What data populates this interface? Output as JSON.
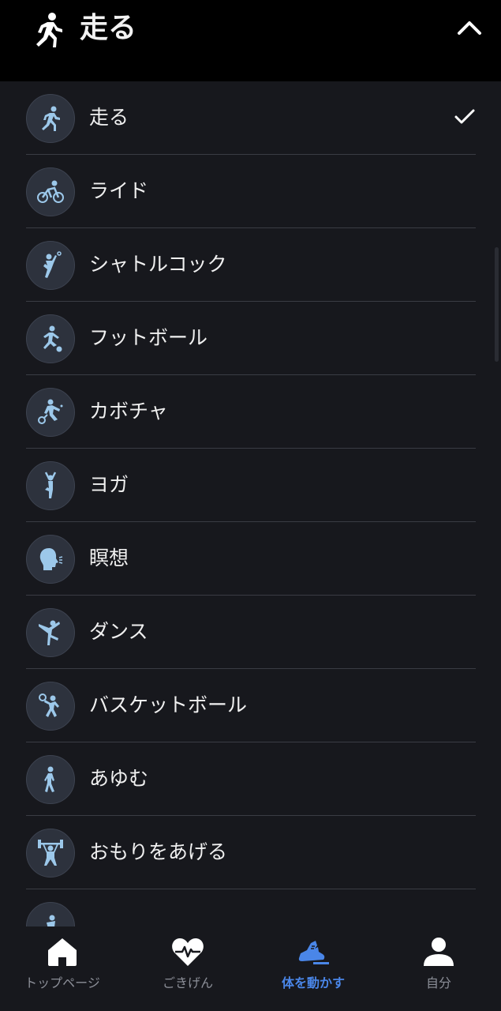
{
  "header": {
    "title": "走る",
    "icon": "running-person-icon",
    "collapse_icon": "chevron-up-icon"
  },
  "activities": [
    {
      "label": "走る",
      "icon": "running-icon",
      "selected": true
    },
    {
      "label": "ライド",
      "icon": "cycling-icon",
      "selected": false
    },
    {
      "label": "シャトルコック",
      "icon": "badminton-icon",
      "selected": false
    },
    {
      "label": "フットボール",
      "icon": "football-icon",
      "selected": false
    },
    {
      "label": "カボチャ",
      "icon": "squash-icon",
      "selected": false
    },
    {
      "label": "ヨガ",
      "icon": "yoga-icon",
      "selected": false
    },
    {
      "label": "瞑想",
      "icon": "meditation-icon",
      "selected": false
    },
    {
      "label": "ダンス",
      "icon": "dance-icon",
      "selected": false
    },
    {
      "label": "バスケットボール",
      "icon": "basketball-icon",
      "selected": false
    },
    {
      "label": "あゆむ",
      "icon": "walking-icon",
      "selected": false
    },
    {
      "label": "おもりをあげる",
      "icon": "weightlifting-icon",
      "selected": false
    }
  ],
  "tabs": [
    {
      "label": "トップページ",
      "icon": "home-icon",
      "active": false
    },
    {
      "label": "ごきげん",
      "icon": "heart-pulse-icon",
      "active": false
    },
    {
      "label": "体を動かす",
      "icon": "sneaker-icon",
      "active": true
    },
    {
      "label": "自分",
      "icon": "person-icon",
      "active": false
    }
  ],
  "colors": {
    "background": "#17181d",
    "header": "#000000",
    "icon_tint": "#9cc8ea",
    "active_tab": "#4a86e8",
    "inactive_tab": "#8c8f98"
  }
}
